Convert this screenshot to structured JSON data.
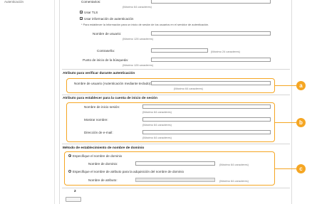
{
  "nav": {
    "item": "Autenticación"
  },
  "top": {
    "comentarios_label": "Comentarios:",
    "comentarios_hint": "(Máximo 64 caracteres)",
    "usar_tls": "Usar TLS",
    "usar_info": "Usar información de autenticación",
    "note": "* Para establecer la información para un inicio de sesión de los usuarios en el servidor de autenticación.",
    "nombre_usuario_label": "Nombre de usuario:",
    "nombre_usuario_hint": "(Máximo 128 caracteres)",
    "contrasena_label": "Contraseña:",
    "contrasena_hint": "(Máximo 24 caracteres)",
    "punto_label": "Punto de inicio de la búsqueda:",
    "punto_hint": "(Máximo 128 caracteres)"
  },
  "verify": {
    "title": "Atributo para verificar durante autenticación",
    "label": "Nombre de usuario (Autenticación mediante teclado):",
    "hint": "(Máximo 64 caracteres)"
  },
  "login": {
    "title": "Atributo para establecer para la cuenta de inicio de sesión",
    "inicio_label": "Nombre de inicio sesión:",
    "inicio_hint": "(Máximo 64 caracteres)",
    "mostrar_label": "Mostrar nombre:",
    "mostrar_hint": "(Máximo 64 caracteres)",
    "email_label": "Dirección de e-mail:",
    "email_hint": "(Máximo 64 caracteres)"
  },
  "domain": {
    "title": "Método de establecimiento de nombre de dominio",
    "opt1": "Especifique el nombre de dominio",
    "dominio_label": "Nombre de dominio:",
    "dominio_hint": "(Máximo 64 caracteres)",
    "opt2": "Especifique el nombre de atributo para la adquisición del nombre de dominio",
    "atributo_label": "Nombre de atributo:",
    "atributo_hint": "(Máximo 64 caracteres)"
  },
  "bottom_marker": "2",
  "callouts": {
    "a": "a",
    "b": "b",
    "c": "c"
  },
  "colors": {
    "callout": "#f5a623"
  }
}
